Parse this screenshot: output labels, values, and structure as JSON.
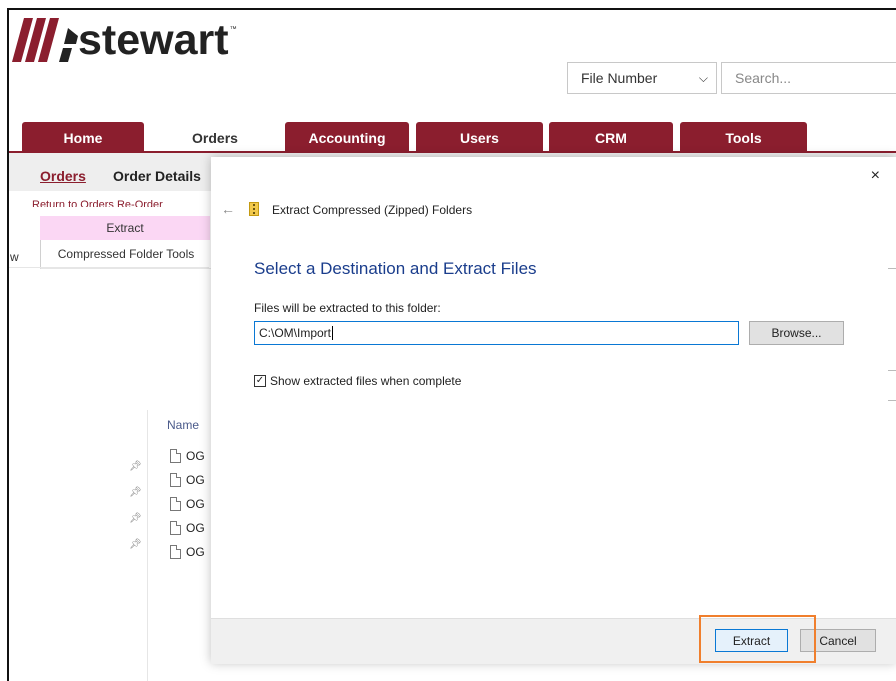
{
  "brand": {
    "name": "stewart",
    "tm": "™"
  },
  "search": {
    "filter_value": "File Number",
    "placeholder": "Search..."
  },
  "tabs": [
    {
      "label": "Home",
      "active": false
    },
    {
      "label": "Orders",
      "active": true
    },
    {
      "label": "Accounting",
      "active": false
    },
    {
      "label": "Users",
      "active": false
    },
    {
      "label": "CRM",
      "active": false
    },
    {
      "label": "Tools",
      "active": false
    }
  ],
  "subnav": {
    "orders": "Orders",
    "order_details": "Order Details",
    "breadcrumbs": "Return to Orders  Re-Order"
  },
  "ribbon": {
    "extract": "Extract",
    "tools": "Compressed Folder Tools",
    "w": "w"
  },
  "explorer": {
    "name_header": "Name",
    "files": [
      "OG",
      "OG",
      "OG",
      "OG",
      "OG"
    ]
  },
  "dialog": {
    "title": "Extract Compressed (Zipped) Folders",
    "heading": "Select a Destination and Extract Files",
    "label": "Files will be extracted to this folder:",
    "path": "C:\\OM\\Import",
    "browse": "Browse...",
    "checkbox_label": "Show extracted files when complete",
    "checkbox_checked": true,
    "extract_button": "Extract",
    "cancel_button": "Cancel",
    "close": "×",
    "back": "←"
  },
  "colors": {
    "brand": "#8b1e2e",
    "accent": "#0a78d4",
    "highlight": "#f07f2d",
    "ribbon": "#fbd7f4"
  }
}
